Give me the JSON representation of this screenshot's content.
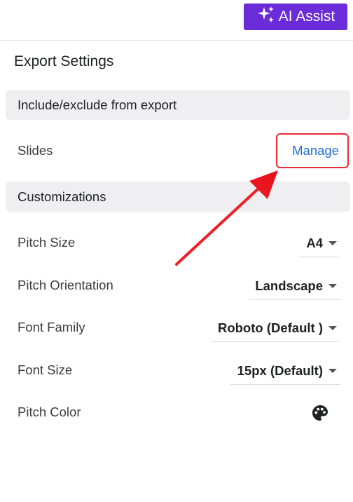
{
  "header": {
    "ai_assist_label": "AI Assist"
  },
  "panel": {
    "title": "Export Settings"
  },
  "include_section": {
    "header": "Include/exclude from export",
    "slides_label": "Slides",
    "manage_label": "Manage"
  },
  "customizations": {
    "header": "Customizations",
    "pitch_size": {
      "label": "Pitch Size",
      "value": "A4"
    },
    "pitch_orientation": {
      "label": "Pitch Orientation",
      "value": "Landscape"
    },
    "font_family": {
      "label": "Font Family",
      "value": "Roboto (Default )"
    },
    "font_size": {
      "label": "Font Size",
      "value": "15px (Default)"
    },
    "pitch_color": {
      "label": "Pitch Color",
      "icon": "palette-icon"
    }
  },
  "colors": {
    "ai_button": "#6a2bd9",
    "link": "#1f6fd8",
    "highlight": "#ee2b35"
  }
}
